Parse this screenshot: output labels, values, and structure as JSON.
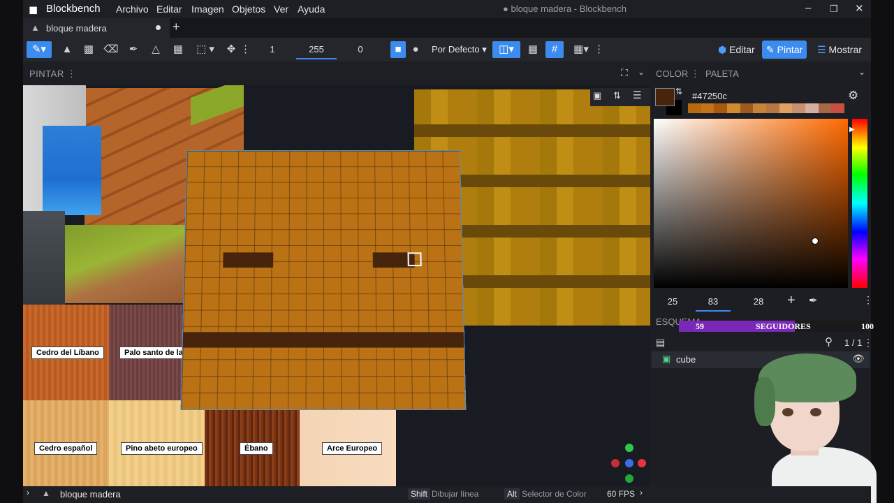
{
  "app": {
    "name": "Blockbench",
    "window_title": "● bloque madera - Blockbench"
  },
  "menu": [
    "Archivo",
    "Editar",
    "Imagen",
    "Objetos",
    "Ver",
    "Ayuda"
  ],
  "tab": {
    "label": "bloque madera"
  },
  "toolbar": {
    "brush_size": "1",
    "opacity": "255",
    "softness": "0",
    "blend_mode": "Por Defecto",
    "modes": [
      "Editar",
      "Pintar",
      "Mostrar"
    ],
    "active_mode": "Pintar"
  },
  "paint_panel": {
    "title": "PINTAR"
  },
  "color_panel": {
    "tabs": [
      "COLOR",
      "PALETA"
    ],
    "hex": "#47250c",
    "hsv": [
      "25",
      "83",
      "28"
    ],
    "swatches": [
      "#b86a10",
      "#c27418",
      "#a85a10",
      "#d08a30",
      "#9c5a20",
      "#c8823a",
      "#b47840",
      "#e0a060",
      "#c89070",
      "#d4b0a0",
      "#a86848",
      "#c85040"
    ]
  },
  "outline_panel": {
    "title": "ESQUEMA",
    "count": "1 / 1",
    "items": [
      {
        "name": "cube"
      }
    ]
  },
  "overlay": {
    "start": "59",
    "label": "SEGUIDORES",
    "end": "100"
  },
  "wood_labels": [
    "Cedro del Líbano",
    "Palo santo de la India",
    "Cedro español",
    "Pino abeto europeo",
    "Ébano",
    "Arce Europeo"
  ],
  "status": {
    "project": "bloque madera",
    "hint1_key": "Shift",
    "hint1": "Dibujar línea",
    "hint2_key": "Alt",
    "hint2": "Selector de Color",
    "fps": "60 FPS"
  },
  "colors": {
    "accent": "#3c8cf0",
    "primary_color": "#47250c",
    "wood": "#ba7214"
  }
}
